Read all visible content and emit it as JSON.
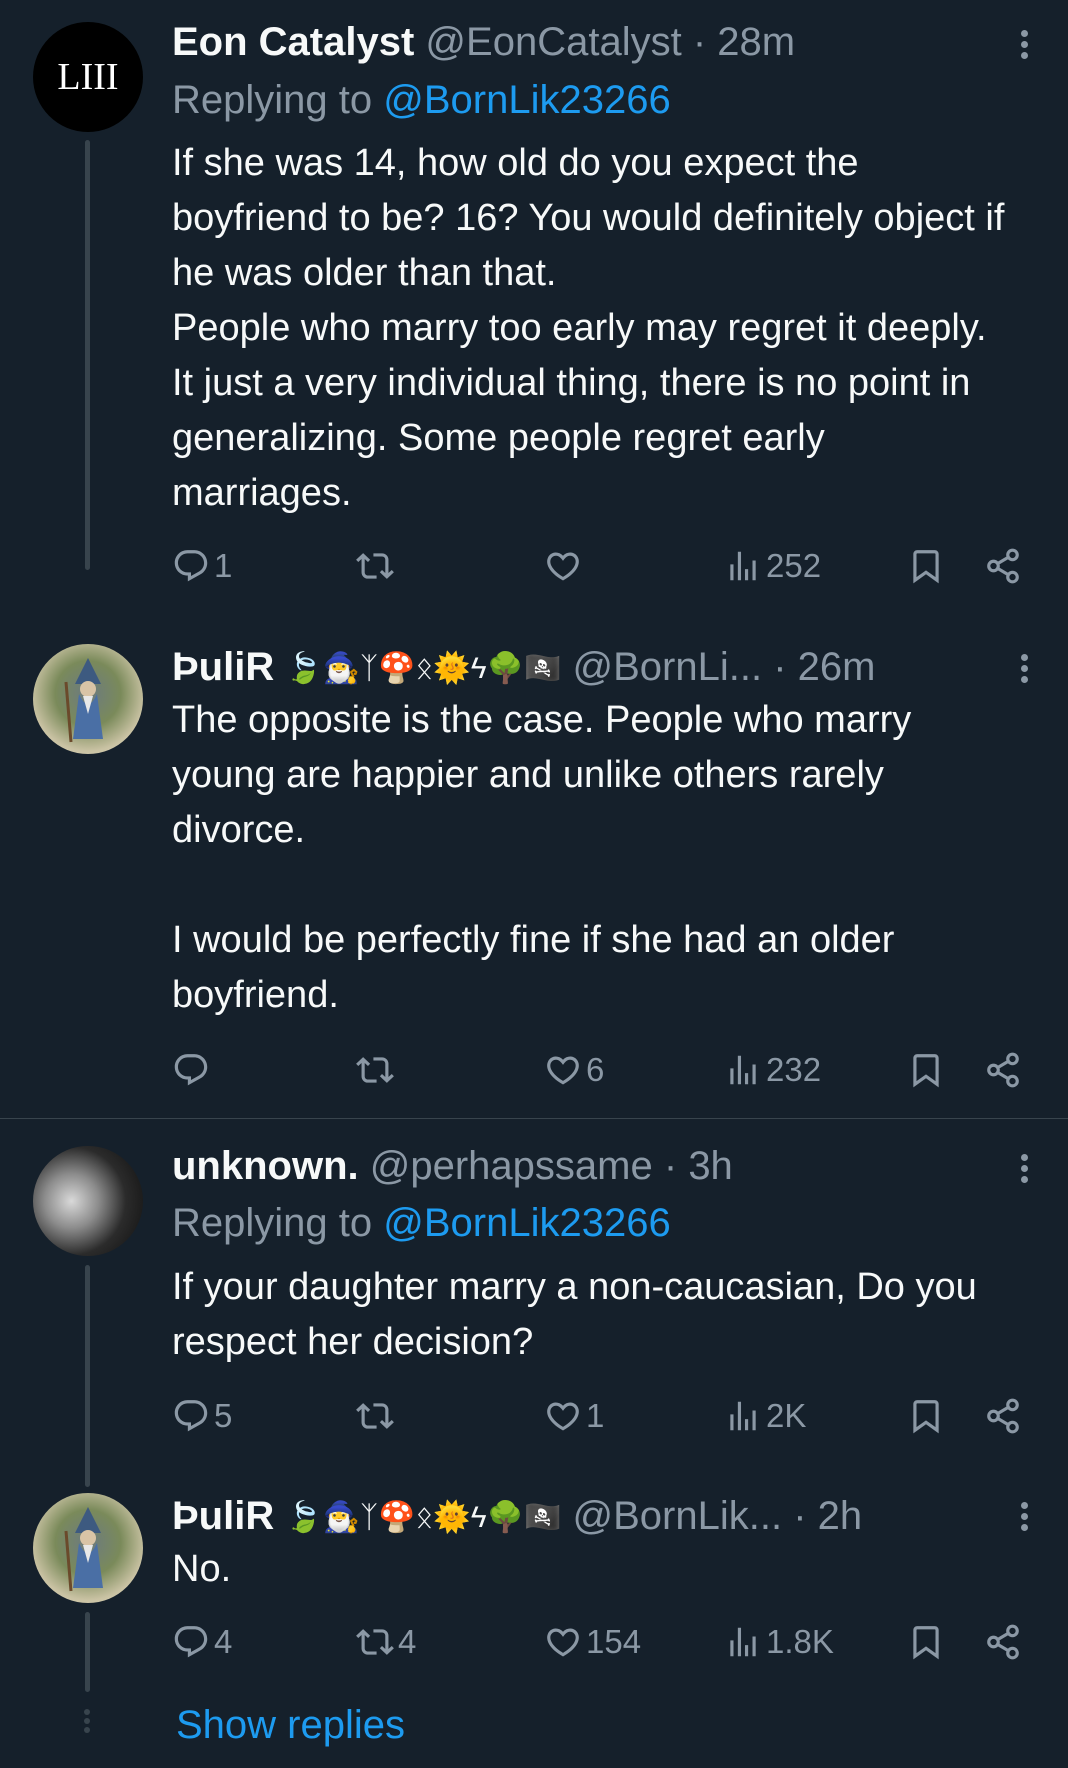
{
  "tweets": [
    {
      "name": "Eon Catalyst",
      "handle": "@EonCatalyst",
      "dot": "·",
      "time": "28m",
      "avatar_text": "LIII",
      "replying_prefix": "Replying to ",
      "replying_to": "@BornLik23266",
      "text": "If she was 14, how old do you expect the boyfriend to be? 16? You would definitely object if he was older than that.\nPeople who marry too early may regret it deeply. It just a very individual thing, there is no point in generalizing. Some people regret early marriages.",
      "replies": "1",
      "retweets": "",
      "likes": "",
      "views": "252"
    },
    {
      "name": "ÞuliR",
      "name_emojis": "🍃🧙‍♂️ᛉ🍄ᛟ🌞ϟ🌳🏴‍☠️",
      "handle": "@BornLi...",
      "dot": "·",
      "time": "26m",
      "text": "The opposite is the case. People who marry young are happier and unlike others rarely divorce.\n\nI would be perfectly fine if she had an older boyfriend.",
      "replies": "",
      "retweets": "",
      "likes": "6",
      "views": "232"
    },
    {
      "name": "unknown.",
      "handle": "@perhapssame",
      "dot": "·",
      "time": "3h",
      "replying_prefix": "Replying to ",
      "replying_to": "@BornLik23266",
      "text": "If your daughter marry a non-caucasian, Do you respect her decision?",
      "replies": "5",
      "retweets": "",
      "likes": "1",
      "views": "2K"
    },
    {
      "name": "ÞuliR",
      "name_emojis": "🍃🧙‍♂️ᛉ🍄ᛟ🌞ϟ🌳🏴‍☠️",
      "handle": "@BornLik...",
      "dot": "·",
      "time": "2h",
      "text": "No.",
      "replies": "4",
      "retweets": "4",
      "likes": "154",
      "views": "1.8K"
    }
  ],
  "show_replies": "Show replies",
  "icons": [
    "reply-icon",
    "retweet-icon",
    "like-icon",
    "views-icon",
    "bookmark-icon",
    "share-icon",
    "more-icon"
  ],
  "colors": {
    "background": "#15202b",
    "text": "#f7f9f9",
    "muted": "#8b98a5",
    "accent": "#1d9bf0",
    "line": "#38444d"
  }
}
